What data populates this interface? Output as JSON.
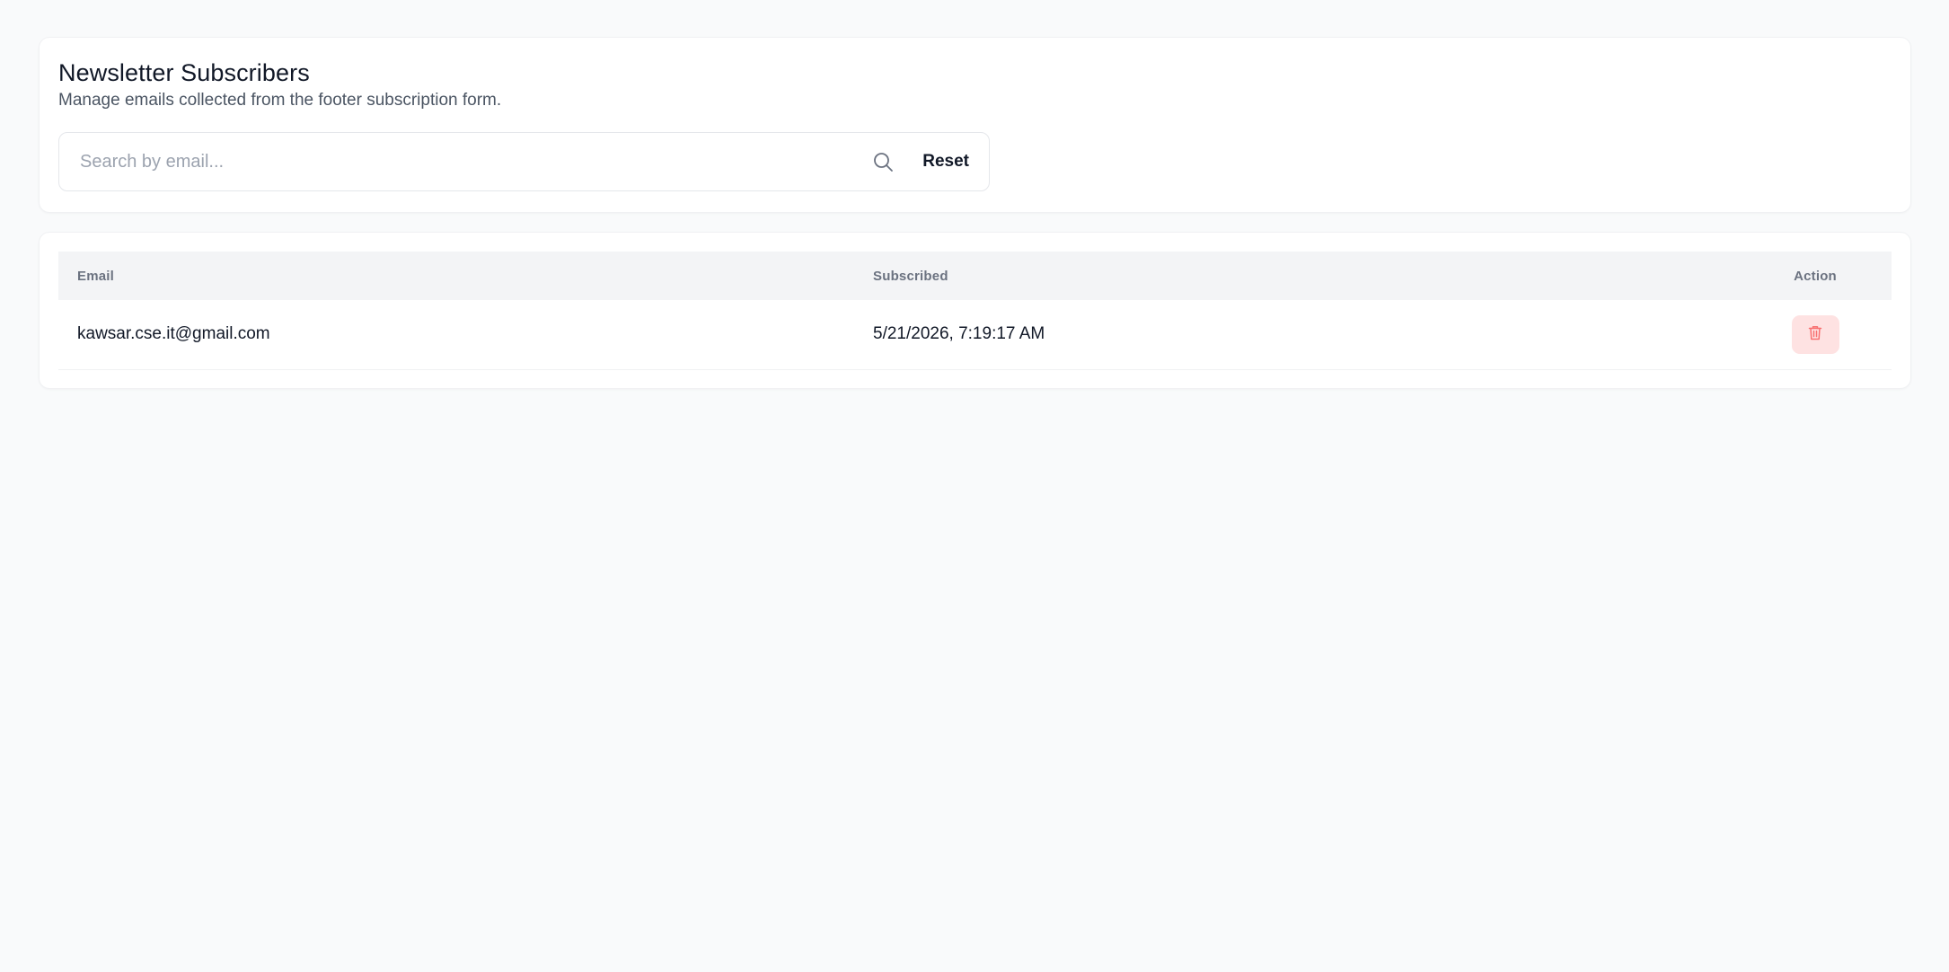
{
  "header": {
    "title": "Newsletter Subscribers",
    "subtitle": "Manage emails collected from the footer subscription form."
  },
  "search": {
    "placeholder": "Search by email...",
    "value": "",
    "icon": "search-icon",
    "reset_label": "Reset"
  },
  "table": {
    "columns": {
      "email": "Email",
      "subscribed": "Subscribed",
      "action": "Action"
    },
    "rows": [
      {
        "email": "kawsar.cse.it@gmail.com",
        "subscribed": "5/21/2026, 7:19:17 AM",
        "action_icon": "trash-icon"
      }
    ]
  },
  "colors": {
    "page_background": "#f9fafb",
    "card_background": "#ffffff",
    "table_header_background": "#f3f4f6",
    "delete_button_background": "#fee2e2",
    "delete_icon_color": "#f87171"
  }
}
